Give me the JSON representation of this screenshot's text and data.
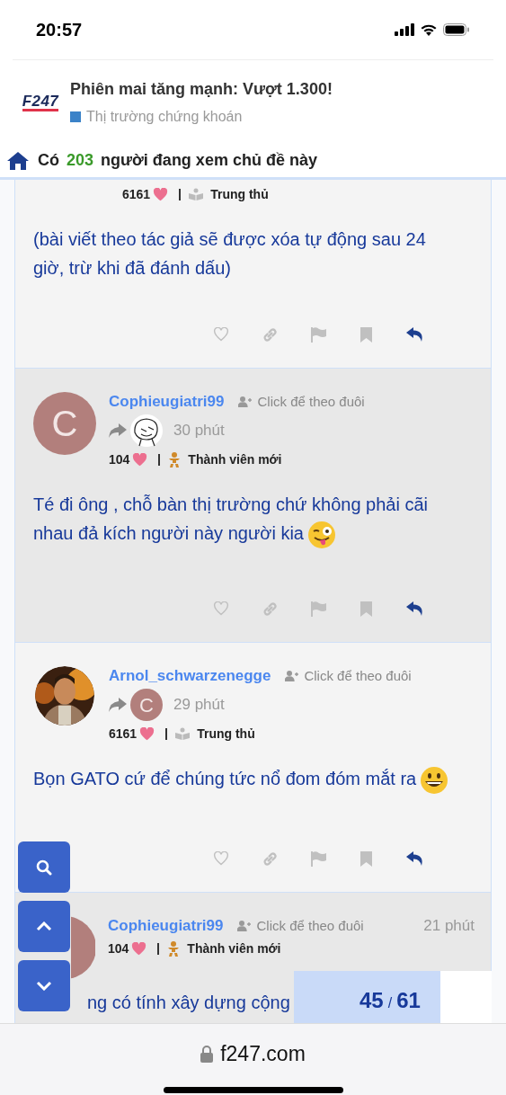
{
  "status_bar": {
    "time": "20:57"
  },
  "topic": {
    "logo": "F247",
    "title": "Phiên mai tăng mạnh: Vượt 1.300!",
    "category": {
      "label": "Thị trường chứng khoán",
      "color": "#3b82c8"
    }
  },
  "viewers": {
    "prefix": "Có",
    "count": "203",
    "suffix": "người đang xem chủ đề này"
  },
  "posts": [
    {
      "likes": "6161",
      "rank": {
        "label": "Trung thủ",
        "kind": "book"
      },
      "body": "(bài viết theo tác giả sẽ được xóa tự động sau 24 giờ, trừ khi đã đánh dấu)",
      "actions": [
        {
          "kind": "like"
        },
        {
          "kind": "link"
        },
        {
          "kind": "flag"
        },
        {
          "kind": "bookmark"
        },
        {
          "kind": "reply"
        }
      ]
    },
    {
      "avatar": {
        "kind": "letter",
        "letter": "C"
      },
      "author": "Cophieugiatri99",
      "follow": "Click để theo đuôi",
      "reply_to": {
        "kind": "sketch"
      },
      "time": "30 phút",
      "likes": "104",
      "rank": {
        "label": "Thành viên mới",
        "kind": "newbie"
      },
      "body": "Té đi ông , chỗ bàn thị trường chứ không phải cãi nhau đả kích người này người kia",
      "emoji": {
        "kind": "wink"
      },
      "actions": [
        {
          "kind": "like"
        },
        {
          "kind": "link"
        },
        {
          "kind": "flag"
        },
        {
          "kind": "bookmark"
        },
        {
          "kind": "reply"
        }
      ]
    },
    {
      "author": "Arnol_schwarzenegge",
      "follow": "Click để theo đuôi",
      "reply_to": {
        "kind": "letter",
        "letter": "C"
      },
      "time": "29 phút",
      "likes": "6161",
      "rank": {
        "label": "Trung thủ",
        "kind": "book"
      },
      "body": "Bọn GATO cứ để chúng tức nổ đom đóm mắt ra",
      "emoji": {
        "kind": "grin"
      },
      "actions": [
        {
          "kind": "like"
        },
        {
          "kind": "link"
        },
        {
          "kind": "flag"
        },
        {
          "kind": "bookmark"
        },
        {
          "kind": "reply"
        }
      ]
    },
    {
      "avatar": {
        "kind": "covered"
      },
      "author": "Cophieugiatri99",
      "follow": "Click để theo đuôi",
      "time": "21 phút",
      "likes": "104",
      "rank": {
        "label": "Thành viên mới",
        "kind": "newbie"
      },
      "body": "ng có tính xây dựng cộng"
    }
  ],
  "progress": {
    "current": "45",
    "separator": "/",
    "total": "61",
    "level": 0.74
  },
  "browser": {
    "url": "f247.com"
  }
}
